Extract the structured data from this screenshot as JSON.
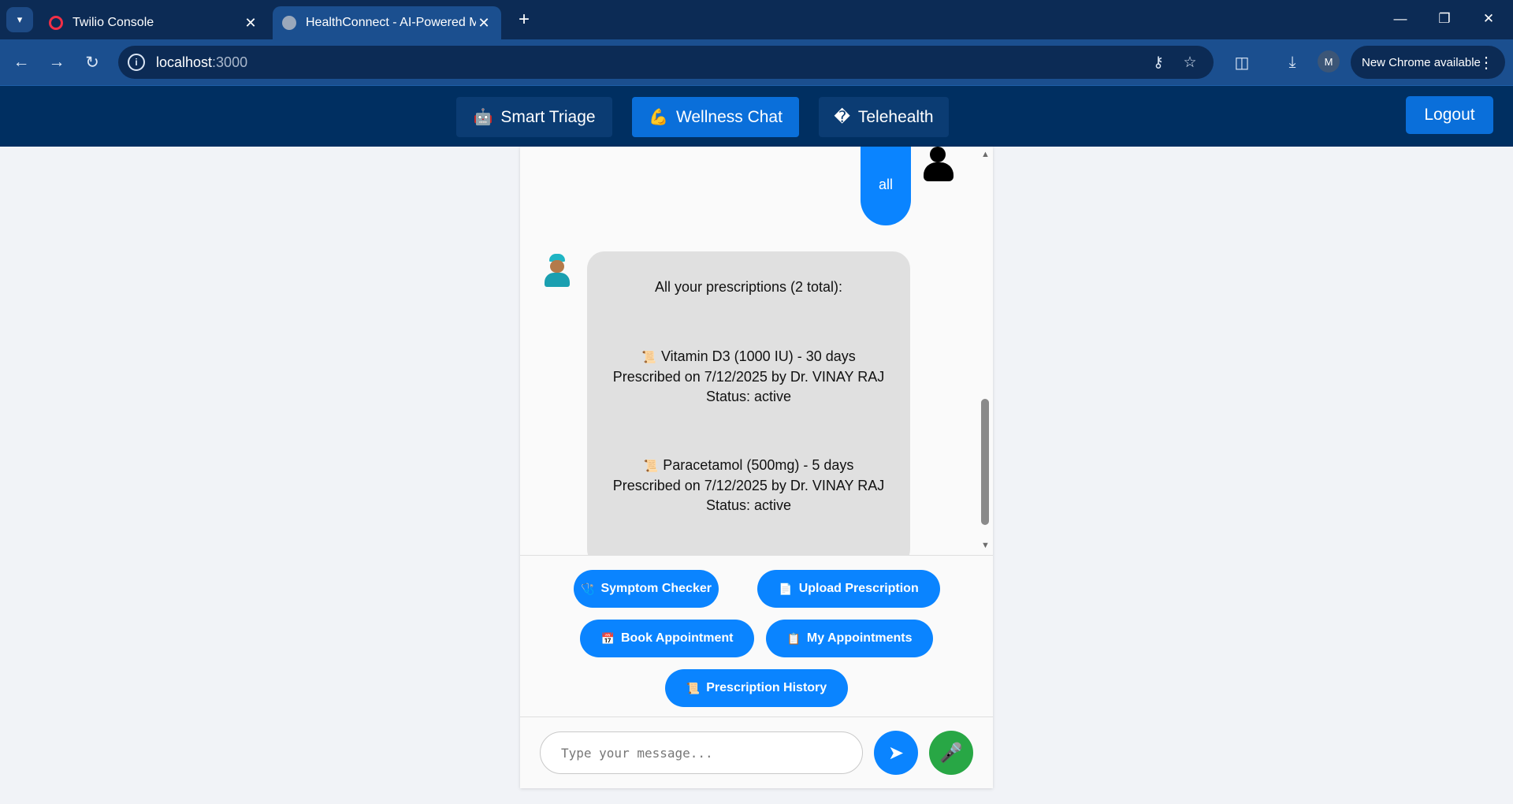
{
  "browser": {
    "tabs": [
      {
        "title": "Twilio Console",
        "active": false
      },
      {
        "title": "HealthConnect - AI-Powered M",
        "active": true
      }
    ],
    "new_tab": "+",
    "url_host": "localhost",
    "url_port": ":3000",
    "profile_initial": "M",
    "update_label": "New Chrome available"
  },
  "header": {
    "tabs": [
      {
        "icon": "🤖",
        "label": "Smart Triage",
        "active": false
      },
      {
        "icon": "💪",
        "label": "Wellness Chat",
        "active": true
      },
      {
        "icon": "�",
        "label": "Telehealth",
        "active": false
      }
    ],
    "logout_label": "Logout"
  },
  "chat": {
    "user_message": "all",
    "bot_message": {
      "heading": "All your prescriptions (2 total):",
      "prescriptions": [
        {
          "icon": "📜",
          "line1": "Vitamin D3 (1000 IU) - 30 days",
          "line2": "Prescribed on 7/12/2025 by Dr. VINAY RAJ",
          "line3": "Status: active"
        },
        {
          "icon": "📜",
          "line1": "Paracetamol (500mg) - 5 days",
          "line2": "Prescribed on 7/12/2025 by Dr. VINAY RAJ",
          "line3": "Status: active"
        }
      ]
    },
    "quick_actions": [
      {
        "icon": "🩺",
        "label": "Symptom Checker"
      },
      {
        "icon": "📄",
        "label": "Upload Prescription"
      },
      {
        "icon": "📅",
        "label": "Book Appointment"
      },
      {
        "icon": "📋",
        "label": "My Appointments"
      },
      {
        "icon": "📜",
        "label": "Prescription History"
      }
    ],
    "input_placeholder": "Type your message...",
    "input_value": "",
    "send_icon": "➤",
    "mic_icon": "🎤"
  },
  "colors": {
    "header_bg": "#002f61",
    "accent_blue": "#0a84ff",
    "mic_green": "#28a745",
    "bot_bubble": "#e0e0e0"
  }
}
